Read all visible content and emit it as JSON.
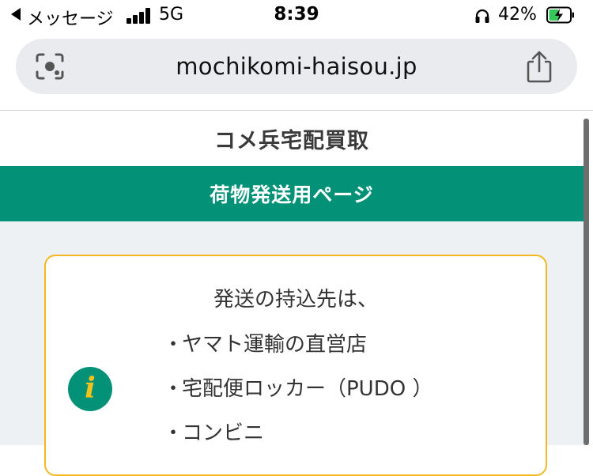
{
  "status_bar": {
    "back_label": "メッセージ",
    "network": "5G",
    "time": "8:39",
    "battery_percent": "42%"
  },
  "browser": {
    "url": "mochikomi-haisou.jp"
  },
  "page": {
    "header_title": "コメ兵宅配買取",
    "banner_title": "荷物発送用ページ",
    "info": {
      "heading": "発送の持込先は、",
      "bullet": "・",
      "items": [
        "ヤマト運輸の直営店",
        "宅配便ロッカー（PUDO ）",
        "コンビニ"
      ]
    }
  },
  "colors": {
    "brand_green": "#039277",
    "card_border": "#f5b820",
    "info_icon_glyph": "#f6c21a",
    "page_background": "#eef1f4"
  },
  "icons": {
    "camera": "camera-scan-icon",
    "share": "share-icon",
    "info": "info-icon"
  }
}
